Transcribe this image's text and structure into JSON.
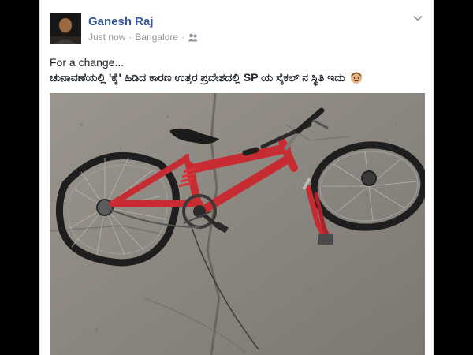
{
  "post": {
    "author_name": "Ganesh Raj",
    "timestamp": "Just now",
    "separator": "·",
    "location": "Bangalore",
    "audience_icon": "friends-icon",
    "menu_icon": "chevron-down-icon",
    "text_line1": "For a change...",
    "text_line2": "ಚುನಾವಣೆಯಲ್ಲಿ 'ಕೈ' ಹಿಡಿದ ಕಾರಣ ಉತ್ತರ ಪ್ರದೇಶದಲ್ಲಿ SP ಯ ಸೈಕಲ್ ನ ಸ್ಥಿತಿ ಇದು",
    "emoji_icon": "person-emoji-icon",
    "photo_subject": "broken-red-bicycle-photo"
  },
  "colors": {
    "author": "#365899",
    "meta": "#90949c",
    "text": "#1d2129",
    "bike": "#c62c32"
  }
}
